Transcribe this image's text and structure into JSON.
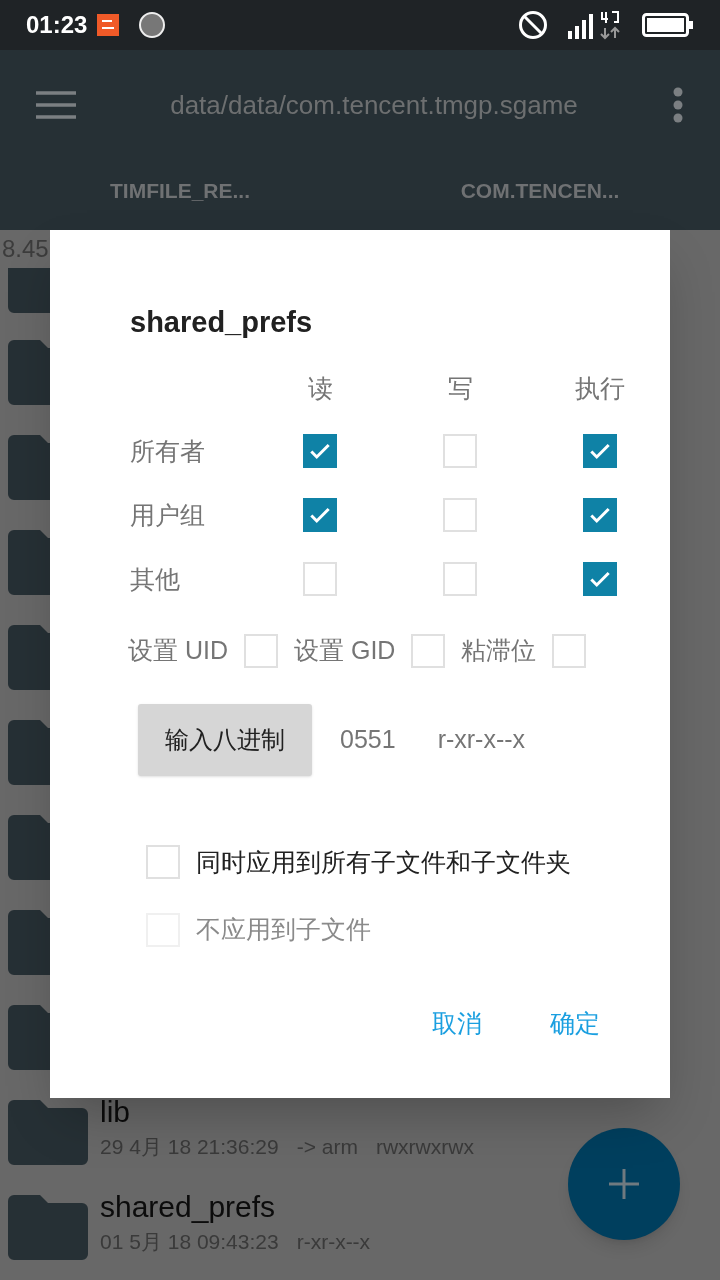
{
  "status_bar": {
    "time": "01:23"
  },
  "app_bar": {
    "title": "data/data/com.tencent.tmgp.sgame"
  },
  "tabs": [
    {
      "label": "TIMFILE_RE..."
    },
    {
      "label": "COM.TENCEN..."
    }
  ],
  "file_list": {
    "cut_text": "8.45",
    "rows": [
      {
        "kind": "cut"
      },
      {
        "kind": "folder"
      },
      {
        "kind": "folder"
      },
      {
        "kind": "folder"
      },
      {
        "kind": "folder"
      },
      {
        "kind": "folder"
      },
      {
        "kind": "folder"
      },
      {
        "kind": "folder"
      },
      {
        "kind": "folder"
      },
      {
        "kind": "folder",
        "name": "lib",
        "details": [
          "29 4月 18 21:36:29",
          "-> arm",
          "rwxrwxrwx"
        ]
      },
      {
        "kind": "folder",
        "name": "shared_prefs",
        "details": [
          "01 5月 18 09:43:23",
          "r-xr-x--x"
        ]
      }
    ]
  },
  "dialog": {
    "title": "shared_prefs",
    "columns": [
      "读",
      "写",
      "执行"
    ],
    "rows": [
      {
        "label": "所有者",
        "checks": [
          {
            "checked": true
          },
          {
            "checked": false
          },
          {
            "checked": true
          }
        ]
      },
      {
        "label": "用户组",
        "checks": [
          {
            "checked": true
          },
          {
            "checked": false
          },
          {
            "checked": true
          }
        ]
      },
      {
        "label": "其他",
        "checks": [
          {
            "checked": false
          },
          {
            "checked": false
          },
          {
            "checked": true
          }
        ]
      }
    ],
    "special": [
      {
        "label": "设置 UID",
        "checked": false
      },
      {
        "label": "设置 GID",
        "checked": false
      },
      {
        "label": "粘滞位",
        "checked": false
      }
    ],
    "octal_button": "输入八进制",
    "octal_value": "0551",
    "symbolic": "r-xr-x--x",
    "options": [
      {
        "label": "同时应用到所有子文件和子文件夹",
        "checked": false,
        "disabled": false
      },
      {
        "label": "不应用到子文件",
        "checked": false,
        "disabled": true
      }
    ],
    "actions": [
      "取消",
      "确定"
    ]
  }
}
